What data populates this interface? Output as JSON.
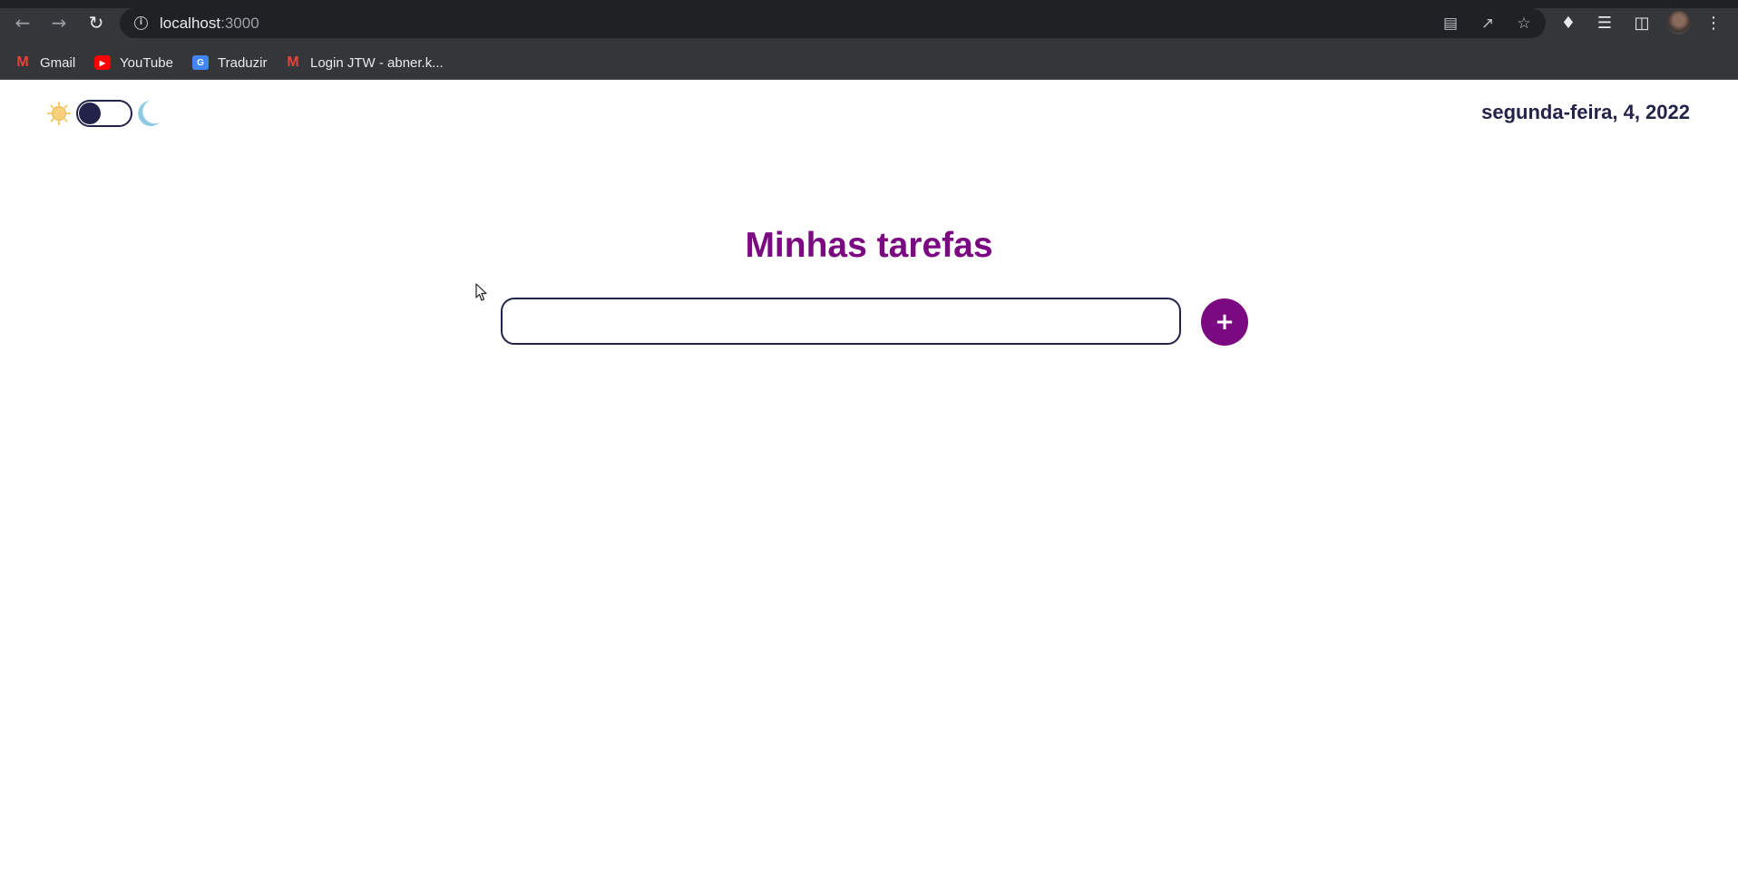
{
  "browser": {
    "url_host": "localhost",
    "url_port": ":3000",
    "icons": {
      "back": "back-arrow-icon",
      "forward": "forward-arrow-icon",
      "reload": "reload-icon",
      "site_info": "info-icon",
      "translate": "translate-icon",
      "share": "share-icon",
      "bookmark_star": "star-icon",
      "extensions": "puzzle-icon",
      "media": "media-queue-icon",
      "side_panel": "side-panel-icon",
      "menu": "kebab-menu-icon"
    },
    "bookmarks": [
      {
        "label": "Gmail",
        "icon": "gmail-icon"
      },
      {
        "label": "YouTube",
        "icon": "youtube-icon"
      },
      {
        "label": "Traduzir",
        "icon": "google-translate-icon"
      },
      {
        "label": "Login JTW - abner.k...",
        "icon": "gmail-icon"
      }
    ]
  },
  "page": {
    "theme_toggle": {
      "mode": "light",
      "sun_icon": "sun-icon",
      "moon_icon": "moon-icon"
    },
    "date_text": "segunda-feira, 4, 2022",
    "title": "Minhas tarefas",
    "task_input": {
      "value": "",
      "placeholder": ""
    },
    "add_button_label": "+",
    "colors": {
      "accent": "#7b0a82",
      "text_dark": "#23234a",
      "sun": "#f5c96a",
      "moon": "#8ecae6"
    }
  }
}
